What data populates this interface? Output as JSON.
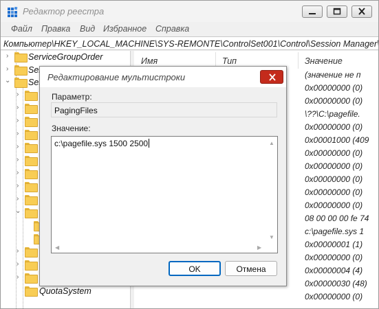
{
  "window": {
    "title": "Редактор реестра",
    "menu": [
      "Файл",
      "Правка",
      "Вид",
      "Избранное",
      "Справка"
    ],
    "address": "Компьютер\\HKEY_LOCAL_MACHINE\\SYS-REMONTE\\ControlSet001\\Control\\Session Manager\\Mem"
  },
  "tree": {
    "items": [
      {
        "label": "ServiceGroupOrder"
      },
      {
        "label": "Servi"
      },
      {
        "label": "Sessi"
      },
      {
        "label": "QuotaSystem"
      }
    ]
  },
  "list": {
    "columns": {
      "name": "Имя",
      "type": "Тип",
      "value": "Значение"
    },
    "values": [
      "(значение не п",
      "0x00000000 (0)",
      "0x00000000 (0)",
      "\\??\\C:\\pagefile.",
      "0x00000000 (0)",
      "0x00001000 (409",
      "0x00000000 (0)",
      "0x00000000 (0)",
      "0x00000000 (0)",
      "0x00000000 (0)",
      "0x00000000 (0)",
      "08 00 00 00 fe 74",
      "c:\\pagefile.sys 1",
      "0x00000001 (1)",
      "0x00000000 (0)",
      "0x00000004 (4)",
      "0x00000030 (48)",
      "0x00000000 (0)"
    ]
  },
  "dialog": {
    "title": "Редактирование мультистроки",
    "param_label": "Параметр:",
    "param_value": "PagingFiles",
    "value_label": "Значение:",
    "value_text": "c:\\pagefile.sys 1500 2500",
    "ok_label": "OK",
    "cancel_label": "Отмена"
  },
  "colors": {
    "close_button": "#c42b1c",
    "ok_border": "#0067c0",
    "folder": "#f8cd55"
  }
}
